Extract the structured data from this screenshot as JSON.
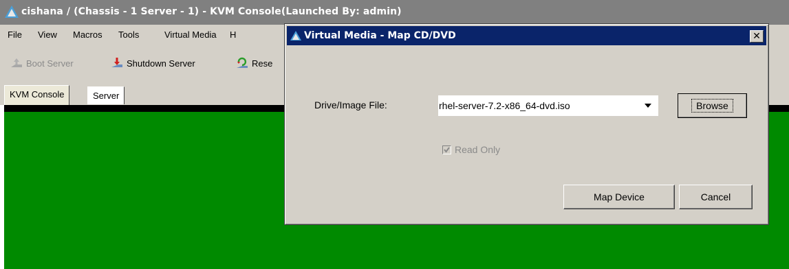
{
  "window": {
    "title": "cishana / (Chassis - 1 Server - 1) - KVM Console(Launched By: admin)"
  },
  "menubar": {
    "items": [
      "File",
      "View",
      "Macros",
      "Tools",
      "Virtual Media",
      "H"
    ]
  },
  "toolbar": {
    "boot_server": "Boot Server",
    "shutdown_server": "Shutdown Server",
    "reset": "Rese"
  },
  "tabs": [
    {
      "label": "KVM Console",
      "active": true
    },
    {
      "label": "Server",
      "active": false
    }
  ],
  "dialog": {
    "title": "Virtual Media - Map CD/DVD",
    "close_glyph": "✕",
    "drive_label": "Drive/Image File:",
    "drive_value": "rhel-server-7.2-x86_64-dvd.iso",
    "browse_label": "Browse",
    "read_only_label": "Read Only",
    "read_only_checked": true,
    "read_only_enabled": false,
    "map_device_label": "Map Device",
    "cancel_label": "Cancel"
  },
  "colors": {
    "console_green": "#008a00",
    "dialog_title_bg": "#0a246a",
    "main_title_bg": "#808080"
  },
  "icons": {
    "app": "cisco-triangle-icon",
    "boot": "boot-server-icon",
    "shutdown": "shutdown-icon",
    "reset": "reset-icon",
    "dropdown": "chevron-down-icon",
    "check": "checkmark-icon"
  }
}
